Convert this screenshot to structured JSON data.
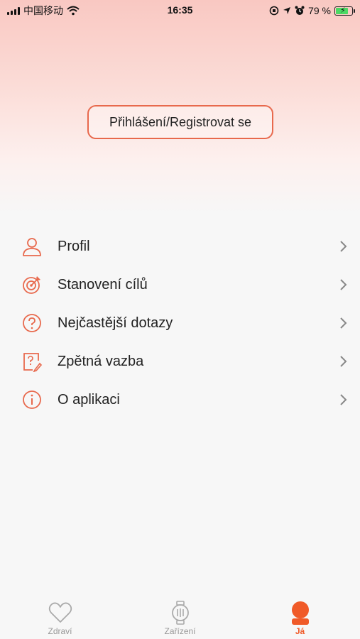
{
  "status_bar": {
    "carrier": "中国移动",
    "time": "16:35",
    "battery_percent": "79 %"
  },
  "login": {
    "label": "Přihlášení/Registrovat se"
  },
  "menu": {
    "items": [
      {
        "label": "Profil",
        "icon": "person-icon"
      },
      {
        "label": "Stanovení cílů",
        "icon": "target-icon"
      },
      {
        "label": "Nejčastější dotazy",
        "icon": "question-circle-icon"
      },
      {
        "label": "Zpětná vazba",
        "icon": "feedback-icon"
      },
      {
        "label": "O aplikaci",
        "icon": "info-icon"
      }
    ]
  },
  "tabs": [
    {
      "label": "Zdraví",
      "icon": "heart-icon",
      "active": false
    },
    {
      "label": "Zařízení",
      "icon": "watch-icon",
      "active": false
    },
    {
      "label": "Já",
      "icon": "user-icon",
      "active": true
    }
  ],
  "colors": {
    "accent": "#e8694d",
    "active_tab": "#f05a28",
    "inactive_tab": "#999999"
  }
}
